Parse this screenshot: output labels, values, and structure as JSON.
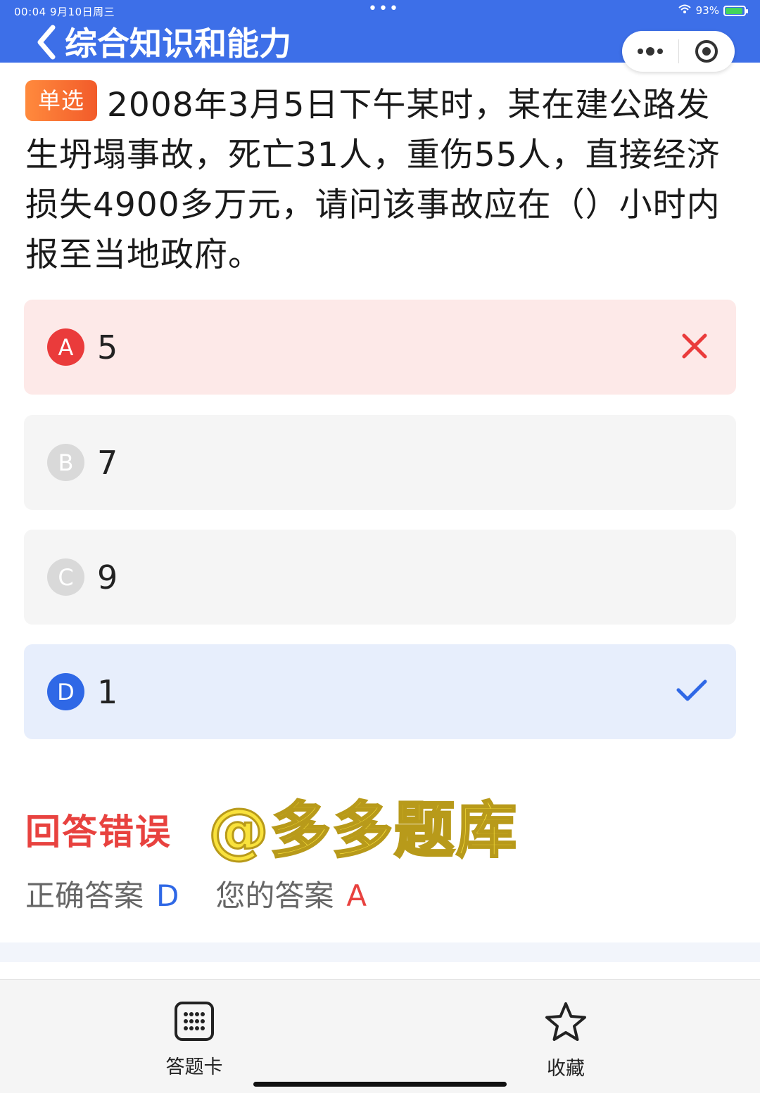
{
  "status_bar": {
    "time_date": "00:04   9月10日周三",
    "dots": "•••",
    "battery_pct": "93%"
  },
  "header": {
    "title": "综合知识和能力"
  },
  "question": {
    "type_badge": "单选",
    "text": "2008年3月5日下午某时，某在建公路发生坍塌事故，死亡31人，重伤55人，直接经济损失4900多万元，请问该事故应在（）小时内报至当地政府。"
  },
  "options": [
    {
      "letter": "A",
      "text": "5",
      "state": "wrong"
    },
    {
      "letter": "B",
      "text": "7",
      "state": "none"
    },
    {
      "letter": "C",
      "text": "9",
      "state": "none"
    },
    {
      "letter": "D",
      "text": "1",
      "state": "correct"
    }
  ],
  "result": {
    "status": "回答错误",
    "watermark": "@多多题库",
    "correct_label": "正确答案",
    "correct_value": "D",
    "yours_label": "您的答案",
    "yours_value": "A"
  },
  "tabbar": {
    "answer_card": "答题卡",
    "favorite": "收藏"
  },
  "colors": {
    "header": "#3d6fe8",
    "wrong": "#ea3b3b",
    "correct": "#2f68e6",
    "badge": "#f25b2a"
  }
}
